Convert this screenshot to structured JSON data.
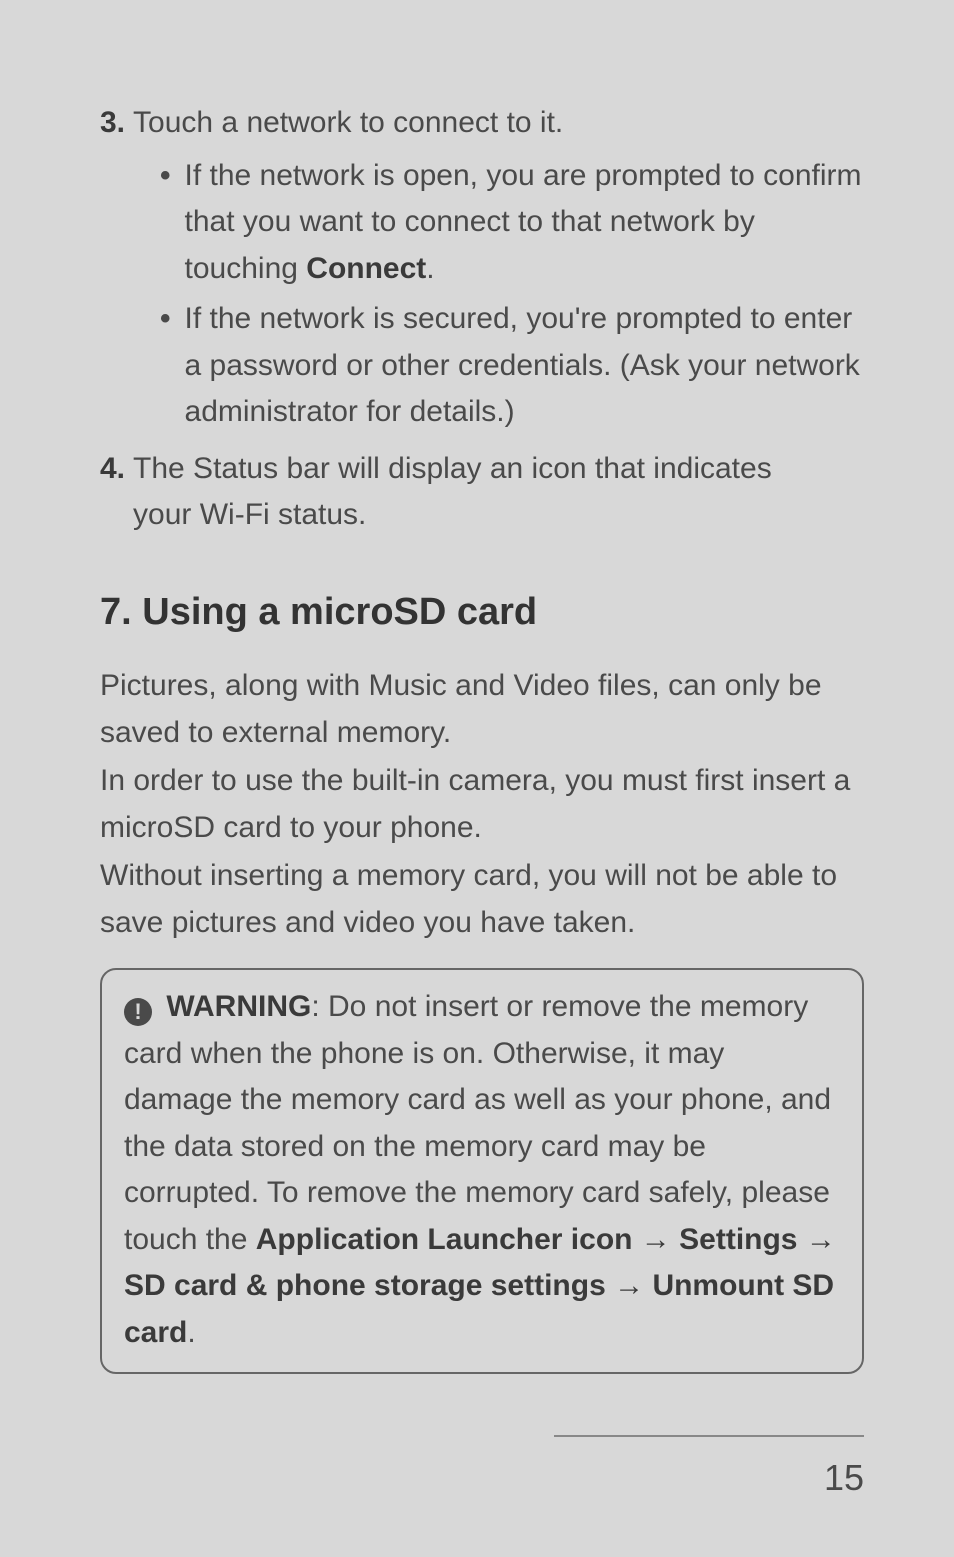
{
  "list": {
    "item3": {
      "num": "3.",
      "text": "Touch a network to connect to it.",
      "bullets": [
        {
          "pre": "If the network is open, you are prompted to confirm that you want to connect to that network by touching ",
          "bold": "Connect",
          "post": "."
        },
        {
          "pre": "If the network is secured, you're prompted to enter a password or other credentials. (Ask your network administrator for details.)",
          "bold": "",
          "post": ""
        }
      ]
    },
    "item4": {
      "num": "4.",
      "text": "The Status bar will display an icon that indicates your Wi-Fi status."
    }
  },
  "section": {
    "heading": "7. Using a microSD card",
    "p1": "Pictures, along with Music and Video files, can only be saved to external memory.",
    "p2": "In order to use the built-in camera, you must first insert a microSD card to your phone.",
    "p3": "Without inserting a memory card, you will not be able to save pictures and video you have taken."
  },
  "warning": {
    "icon_glyph": "!",
    "label": "WARNING",
    "body_pre": ": Do not insert or remove the memory card when the phone is on. Otherwise, it may damage the memory card as well as your phone, and the data stored on the memory card may be corrupted. To remove the memory card safely, please touch the ",
    "path1": "Application Launcher icon",
    "arrow": " → ",
    "path2": "Settings",
    "path3": "SD card & phone storage settings",
    "path4": "Unmount SD card",
    "period": "."
  },
  "page_num": "15"
}
